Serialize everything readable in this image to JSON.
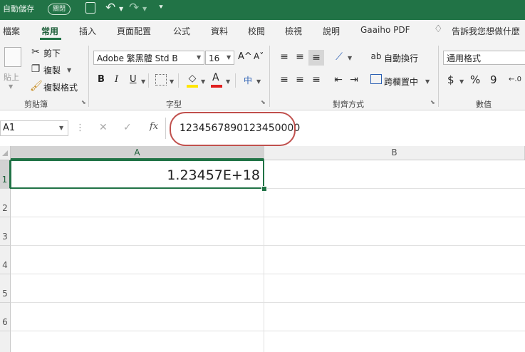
{
  "quick_access": {
    "autosave_label": "自動儲存",
    "autosave_state": "關閉"
  },
  "tabs": [
    "檔案",
    "常用",
    "插入",
    "頁面配置",
    "公式",
    "資料",
    "校閱",
    "檢視",
    "說明",
    "Gaaiho PDF"
  ],
  "active_tab": "常用",
  "tell_me": "告訴我您想做什麼",
  "ribbon": {
    "clipboard": {
      "paste": "貼上",
      "cut": "剪下",
      "copy": "複製",
      "format_painter": "複製格式",
      "group": "剪貼簿"
    },
    "font": {
      "name": "Adobe 繁黑體 Std B",
      "size": "16",
      "bold": "B",
      "italic": "I",
      "underline": "U",
      "font_color_letter": "A",
      "grow": "A^",
      "shrink": "A˅",
      "phonetic": "中",
      "group": "字型"
    },
    "alignment": {
      "wrap_text": "自動換行",
      "merge_center": "跨欄置中",
      "group": "對齊方式"
    },
    "number": {
      "format": "通用格式",
      "currency": "$",
      "percent": "%",
      "comma": "9",
      "group": "數值"
    }
  },
  "formula_bar": {
    "name_box": "A1",
    "cancel": "✕",
    "enter": "✓",
    "fx": "fx",
    "value": "1234567890123450000"
  },
  "sheet": {
    "columns": [
      "A",
      "B"
    ],
    "rows": [
      "1",
      "2",
      "3",
      "4",
      "5",
      "6"
    ],
    "cells": {
      "A1": "1.23457E+18"
    }
  },
  "colors": {
    "accent": "#217346",
    "highlight_ring": "#c0504d",
    "font_color_bar": "#e02020",
    "fill_color_bar": "#ffe600"
  }
}
